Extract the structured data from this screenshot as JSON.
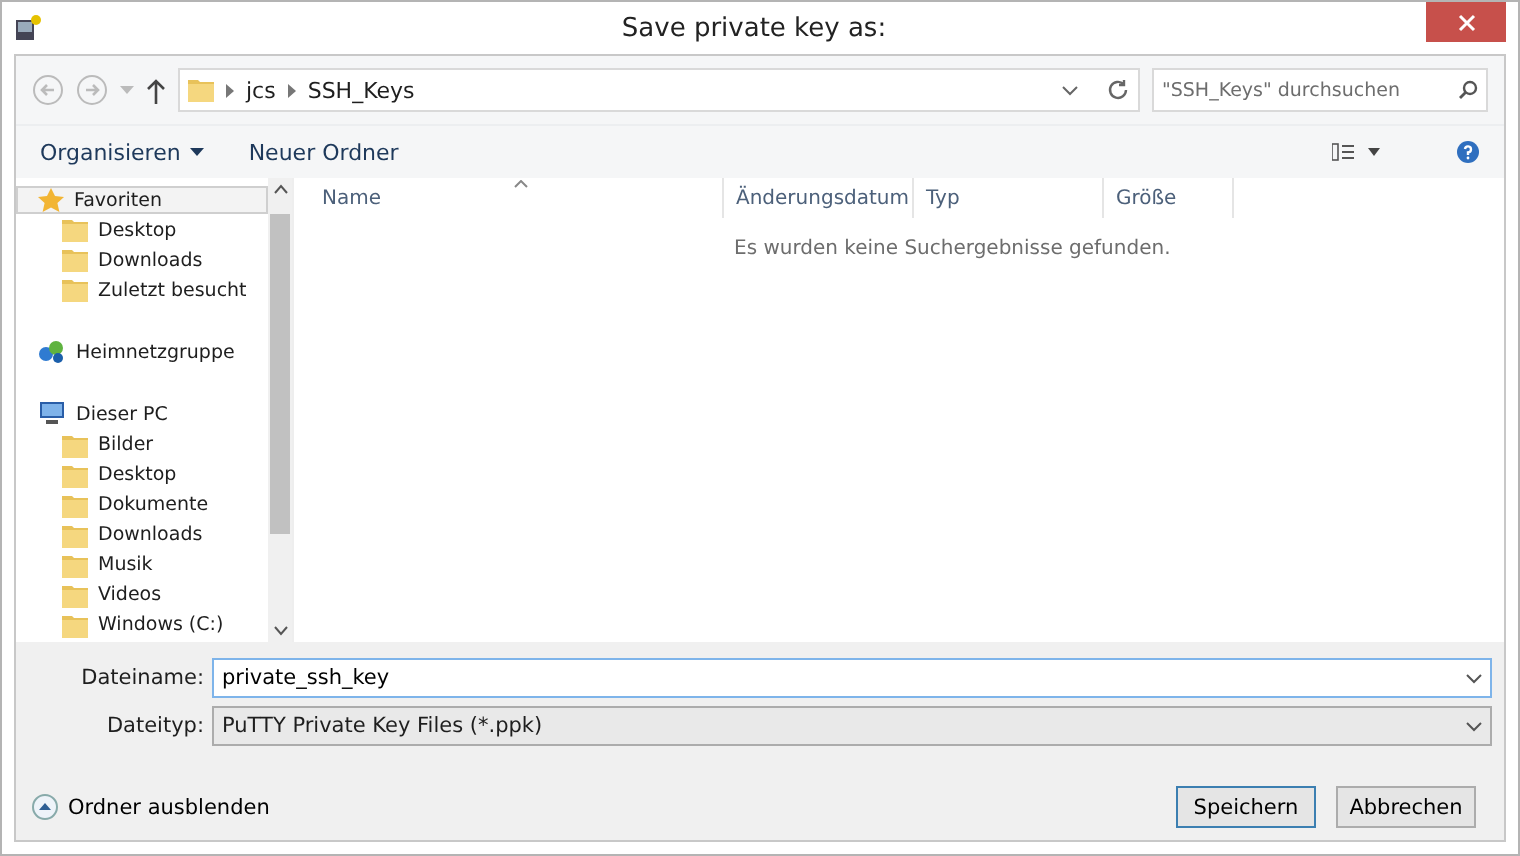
{
  "window": {
    "title": "Save private key as:"
  },
  "address_bar": {
    "path": [
      "jcs",
      "SSH_Keys"
    ]
  },
  "search": {
    "placeholder": "\"SSH_Keys\" durchsuchen"
  },
  "toolbar": {
    "organize": "Organisieren",
    "new_folder": "Neuer Ordner"
  },
  "sidebar": {
    "groups": [
      {
        "kind": "favorites",
        "label": "Favoriten",
        "selected": true,
        "children": [
          {
            "label": "Desktop"
          },
          {
            "label": "Downloads"
          },
          {
            "label": "Zuletzt besucht"
          }
        ]
      },
      {
        "kind": "homegroup",
        "label": "Heimnetzgruppe",
        "selected": false
      },
      {
        "kind": "computer",
        "label": "Dieser PC",
        "selected": false,
        "children": [
          {
            "label": "Bilder"
          },
          {
            "label": "Desktop"
          },
          {
            "label": "Dokumente"
          },
          {
            "label": "Downloads"
          },
          {
            "label": "Musik"
          },
          {
            "label": "Videos"
          },
          {
            "label": "Windows (C:)"
          }
        ]
      }
    ]
  },
  "table": {
    "columns": [
      "Name",
      "Änderungsdatum",
      "Typ",
      "Größe"
    ],
    "empty_message": "Es wurden keine Suchergebnisse gefunden."
  },
  "file_name": {
    "label": "Dateiname:",
    "value": "private_ssh_key"
  },
  "file_type": {
    "label": "Dateityp:",
    "value": "PuTTY Private Key Files (*.ppk)"
  },
  "hide_folders": "Ordner ausblenden",
  "buttons": [
    "Speichern",
    "Abbrechen"
  ]
}
